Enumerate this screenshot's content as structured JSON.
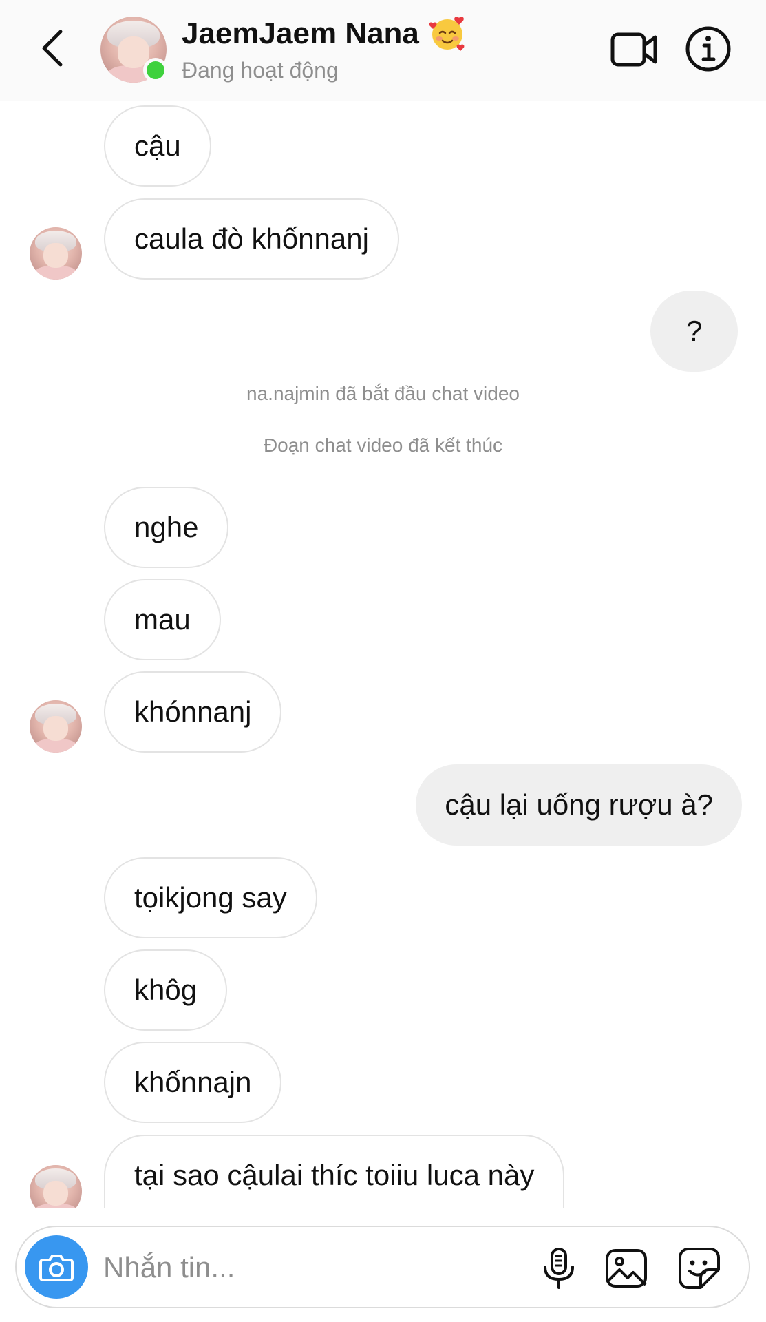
{
  "header": {
    "back_icon": "chevron-left-icon",
    "contact_name": "JaemJaem Nana",
    "name_emoji": "smiling-face-with-hearts",
    "status": "Đang hoạt động",
    "online_color": "#3fd13d",
    "video_icon": "video-camera-icon",
    "info_icon": "info-icon"
  },
  "messages": [
    {
      "direction": "incoming",
      "text": "cậu"
    },
    {
      "direction": "incoming",
      "text": "caula đò khốnnanj"
    },
    {
      "direction": "outgoing",
      "text": "?"
    },
    {
      "direction": "system",
      "text": "na.najmin đã bắt đầu chat video"
    },
    {
      "direction": "system",
      "text": "Đoạn chat video đã kết thúc"
    },
    {
      "direction": "incoming",
      "text": "nghe"
    },
    {
      "direction": "incoming",
      "text": "mau"
    },
    {
      "direction": "incoming",
      "text": "khónnanj"
    },
    {
      "direction": "outgoing",
      "text": "cậu lại uống rượu à?"
    },
    {
      "direction": "incoming",
      "text": "tọikjong say"
    },
    {
      "direction": "incoming",
      "text": "khôg"
    },
    {
      "direction": "incoming",
      "text": "khốnnajn"
    },
    {
      "direction": "incoming",
      "text": "tại sao cậulai thíc toiiu luca này"
    }
  ],
  "composer": {
    "camera_icon": "camera-icon",
    "placeholder": "Nhắn tin...",
    "mic_icon": "microphone-icon",
    "gallery_icon": "image-icon",
    "sticker_icon": "sticker-icon",
    "accent_color": "#3897f0"
  },
  "colors": {
    "incoming_bubble_border": "#e3e3e3",
    "outgoing_bubble_bg": "#efefef",
    "secondary_text": "#8e8e8e"
  }
}
